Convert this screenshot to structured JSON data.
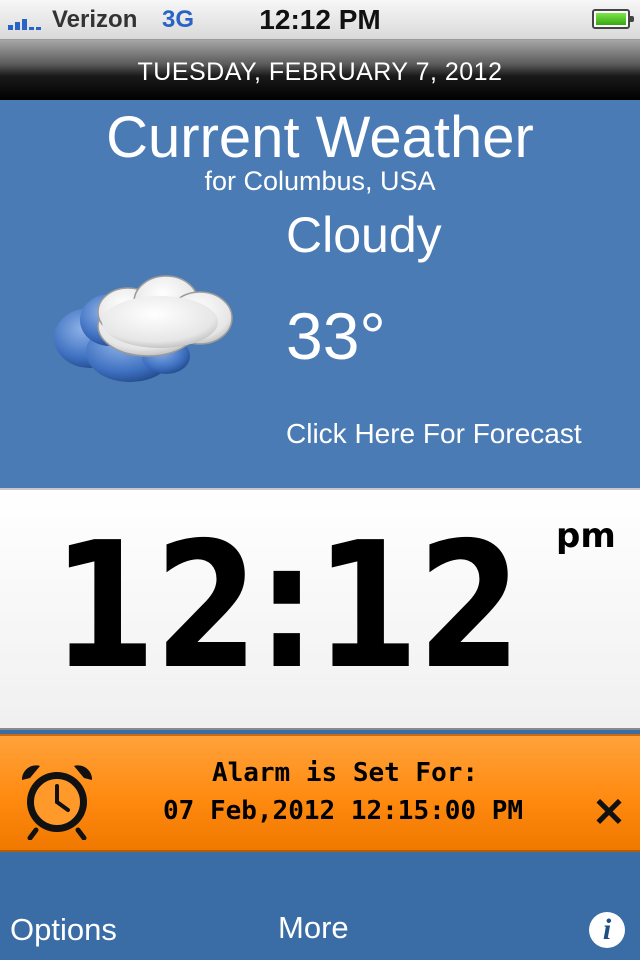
{
  "status_bar": {
    "carrier": "Verizon",
    "network": "3G",
    "time": "12:12 PM",
    "signal_bars": 5,
    "battery_level": "full"
  },
  "date_bar": {
    "date": "TUESDAY, FEBRUARY 7, 2012"
  },
  "weather": {
    "title": "Current Weather",
    "location": "for Columbus, USA",
    "condition": "Cloudy",
    "temperature": "33°",
    "forecast_link": "Click Here For Forecast",
    "icon": "cloud-icon"
  },
  "clock": {
    "time": "12:12",
    "ampm": "pm"
  },
  "alarm": {
    "title": "Alarm is Set For:",
    "datetime": "07 Feb,2012 12:15:00 PM",
    "icon": "alarm-clock-icon",
    "close_icon": "close-icon"
  },
  "bottom_bar": {
    "options_label": "Options",
    "more_label": "More",
    "info_icon": "info-icon"
  },
  "colors": {
    "weather_bg": "#4a7bb4",
    "bottom_bg": "#3a6ca5",
    "alarm_bg": "#ff8a10"
  }
}
